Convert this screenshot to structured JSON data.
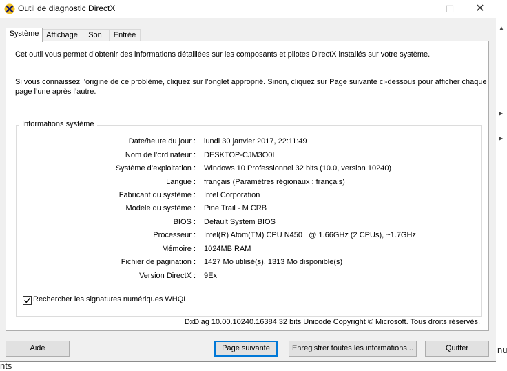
{
  "window": {
    "title": "Outil de diagnostic DirectX",
    "controls": {
      "minimize": "—",
      "maximize": "☐",
      "close": "✕"
    }
  },
  "tabs": [
    {
      "label": "Système",
      "active": true
    },
    {
      "label": "Affichage",
      "active": false
    },
    {
      "label": "Son",
      "active": false
    },
    {
      "label": "Entrée",
      "active": false
    }
  ],
  "intro": {
    "line1": "Cet outil vous permet d’obtenir des informations détaillées sur les composants et pilotes DirectX installés sur votre système.",
    "line2": "Si vous connaissez l’origine de ce problème, cliquez sur l’onglet approprié. Sinon, cliquez sur Page suivante ci-dessous pour afficher chaque",
    "line3": "page l’une après l’autre."
  },
  "system_info": {
    "group_label": "Informations système",
    "rows": [
      {
        "label": "Date/heure du jour :",
        "value": "lundi 30 janvier 2017, 22:11:49"
      },
      {
        "label": "Nom de l’ordinateur :",
        "value": "DESKTOP-CJM3O0I"
      },
      {
        "label": "Système d’exploitation :",
        "value": "Windows 10 Professionnel 32 bits (10.0, version 10240)"
      },
      {
        "label": "Langue :",
        "value": "français (Paramètres régionaux : français)"
      },
      {
        "label": "Fabricant du système :",
        "value": "Intel Corporation"
      },
      {
        "label": "Modèle du système :",
        "value": "Pine Trail - M CRB"
      },
      {
        "label": "BIOS :",
        "value": "Default System BIOS"
      },
      {
        "label": "Processeur :",
        "value": "Intel(R) Atom(TM) CPU N450   @ 1.66GHz (2 CPUs), ~1.7GHz"
      },
      {
        "label": "Mémoire :",
        "value": "1024MB RAM"
      },
      {
        "label": "Fichier de pagination :",
        "value": "1427 Mo utilisé(s), 1313 Mo disponible(s)"
      },
      {
        "label": "Version DirectX :",
        "value": "9Ex"
      }
    ]
  },
  "whql": {
    "label": "Rechercher les signatures numériques WHQL",
    "checked": true
  },
  "copyright": "DxDiag 10.00.10240.16384 32 bits Unicode Copyright © Microsoft. Tous droits réservés.",
  "buttons": {
    "help": "Aide",
    "next": "Page suivante",
    "save": "Enregistrer toutes les informations...",
    "quit": "Quitter"
  },
  "behind": {
    "text_right": "nu",
    "text_bottom": "nts"
  }
}
